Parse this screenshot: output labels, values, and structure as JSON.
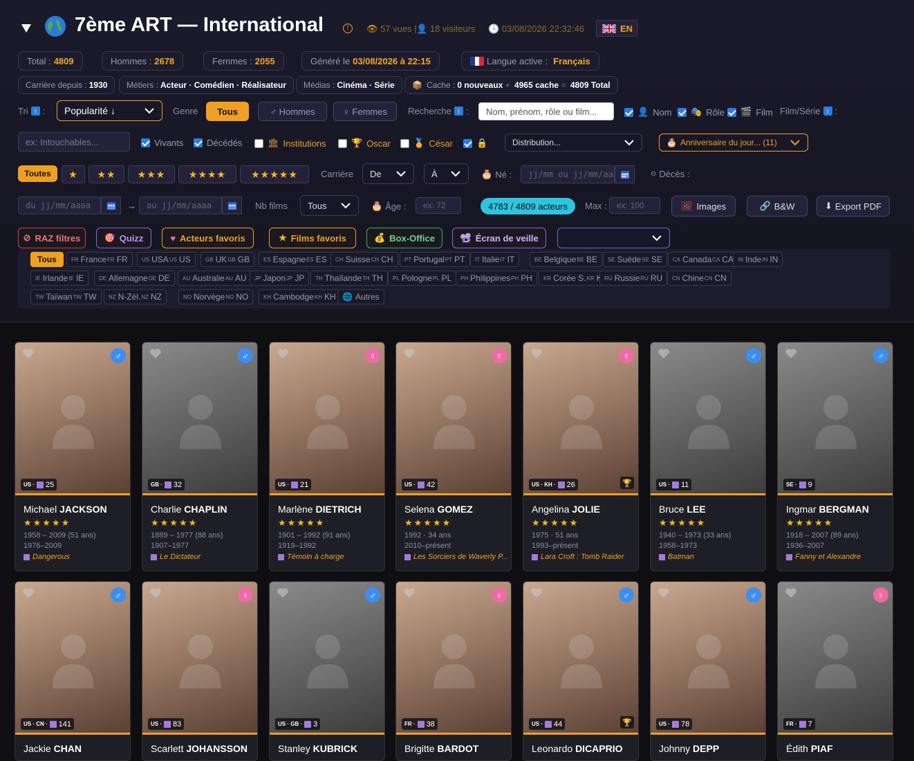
{
  "header": {
    "title": "7ème ART — International",
    "views": "57 vues |",
    "visitors": "18 visiteurs",
    "datetime": "03/08/2026 22:32:46",
    "lang_button": "EN"
  },
  "stats": {
    "total_label": "Total :",
    "total": "4809",
    "men_label": "Hommes :",
    "men": "2678",
    "women_label": "Femmes :",
    "women": "2055",
    "generated_label": "Généré le",
    "generated": "03/08/2026 à 22:15",
    "language_label": "Langue active :",
    "language": "Français"
  },
  "info": {
    "career_label": "Carrière depuis :",
    "career": "1930",
    "jobs_label": "Métiers :",
    "jobs": "Acteur · Comédien · Réalisateur",
    "media_label": "Médias :",
    "media": "Cinéma · Série",
    "cache_label": "Cache :",
    "cache_new": "0 nouveaux",
    "cache_plus": "+",
    "cache_count": "4965 cache",
    "cache_eq": "=",
    "cache_total": "4809 Total"
  },
  "filters": {
    "sort_label": "Tri",
    "sort_value": "Popularité ↓",
    "gender_label": "Genre",
    "gender_all": "Tous",
    "gender_men": "♂ Hommes",
    "gender_women": "♀ Femmes",
    "search_label": "Recherche",
    "search_placeholder": "Nom, prénom, rôle ou film...",
    "opt_name": "Nom",
    "opt_role": "Rôle",
    "opt_film": "Film",
    "filmserie_label": "Film/Série",
    "film_placeholder": "ex: Intouchables...",
    "alive": "Vivants",
    "dead": "Décédés",
    "institutions": "Institutions",
    "oscar": "Oscar",
    "cesar": "César",
    "distribution": "Distribution...",
    "birthday": "Anniversaire du jour... (11)",
    "stars_all": "Toutes",
    "career_label": "Carrière",
    "career_from": "De",
    "career_to": "À",
    "born_label": "Né :",
    "date_placeholder": "jj/mm ou jj/mm/aaaa",
    "death_label": "Décès :",
    "from_placeholder": "du jj/mm/aaaa",
    "arrow": "→",
    "to_placeholder": "au jj/mm/aaaa",
    "nbfilms_label": "Nb films",
    "nbfilms_value": "Tous",
    "age_label": "Âge :",
    "age_min_placeholder": "ex: 72",
    "count_badge": "4783 / 4809 acteurs",
    "max_label": "Max :",
    "max_placeholder": "ex: 100",
    "images": "Images",
    "bw": "B&W",
    "export": "Export PDF"
  },
  "actions": {
    "reset": "RAZ filtres",
    "quiz": "Quizz",
    "fav_actors": "Acteurs favoris",
    "fav_films": "Films favoris",
    "boxoffice": "Box-Office",
    "screensaver": "Écran de veille"
  },
  "countries": [
    {
      "label": "Tous"
    },
    {
      "code": "FR",
      "label": "France",
      "suffix": "FR"
    },
    {
      "code": "US",
      "label": "USA",
      "suffix": "US"
    },
    {
      "code": "GB",
      "label": "UK",
      "suffix": "GB"
    },
    {
      "code": "ES",
      "label": "Espagne",
      "suffix": "ES"
    },
    {
      "code": "CH",
      "label": "Suisse",
      "suffix": "CH"
    },
    {
      "code": "PT",
      "label": "Portugal",
      "suffix": "PT"
    },
    {
      "code": "IT",
      "label": "Italie",
      "suffix": "IT"
    },
    {
      "code": "BE",
      "label": "Belgique",
      "suffix": "BE"
    },
    {
      "code": "SE",
      "label": "Suède",
      "suffix": "SE"
    },
    {
      "code": "CA",
      "label": "Canada",
      "suffix": "CA"
    },
    {
      "code": "IN",
      "label": "Inde",
      "suffix": "IN"
    },
    {
      "code": "IE",
      "label": "Irlande",
      "suffix": "IE"
    },
    {
      "code": "DE",
      "label": "Allemagne",
      "suffix": "DE"
    },
    {
      "code": "AU",
      "label": "Australie",
      "suffix": "AU"
    },
    {
      "code": "JP",
      "label": "Japon",
      "suffix": "JP"
    },
    {
      "code": "TH",
      "label": "Thaïlande",
      "suffix": "TH"
    },
    {
      "code": "PL",
      "label": "Pologne",
      "suffix": "PL"
    },
    {
      "code": "PH",
      "label": "Philippines",
      "suffix": "PH"
    },
    {
      "code": "KR",
      "label": "Corée S.",
      "suffix": "KR"
    },
    {
      "code": "RU",
      "label": "Russie",
      "suffix": "RU"
    },
    {
      "code": "CN",
      "label": "Chine",
      "suffix": "CN"
    },
    {
      "code": "TW",
      "label": "Taïwan",
      "suffix": "TW"
    },
    {
      "code": "NZ",
      "label": "N-Zél.",
      "suffix": "NZ"
    },
    {
      "code": "NO",
      "label": "Norvège",
      "suffix": "NO"
    },
    {
      "code": "KH",
      "label": "Cambodge",
      "suffix": "KH"
    },
    {
      "label": "Autres"
    }
  ],
  "cards": [
    {
      "first": "Michael",
      "last": "JACKSON",
      "sex": "m",
      "countries": "US ·",
      "films": "25",
      "line1": "1958 – 2009 (51 ans)",
      "line2": "1976–2009",
      "film": "Dangerous",
      "trophy": false,
      "color": true
    },
    {
      "first": "Charlie",
      "last": "CHAPLIN",
      "sex": "m",
      "countries": "GB ·",
      "films": "32",
      "line1": "1889 – 1977 (88 ans)",
      "line2": "1907–1977",
      "film": "Le Dictateur",
      "trophy": false,
      "color": false
    },
    {
      "first": "Marlène",
      "last": "DIETRICH",
      "sex": "f",
      "countries": "US ·",
      "films": "21",
      "line1": "1901 – 1992 (91 ans)",
      "line2": "1919–1992",
      "film": "Témoin à charge",
      "trophy": false,
      "color": true
    },
    {
      "first": "Selena",
      "last": "GOMEZ",
      "sex": "f",
      "countries": "US ·",
      "films": "42",
      "line1": "1992 · 34 ans",
      "line2": "2010–présent",
      "film": "Les Sorciers de Waverly P...",
      "trophy": false,
      "color": true
    },
    {
      "first": "Angelina",
      "last": "JOLIE",
      "sex": "f",
      "countries": "US · KH ·",
      "films": "26",
      "line1": "1975 · 51 ans",
      "line2": "1993–présent",
      "film": "Lara Croft : Tomb Raider",
      "trophy": true,
      "color": true
    },
    {
      "first": "Bruce",
      "last": "LEE",
      "sex": "m",
      "countries": "US ·",
      "films": "11",
      "line1": "1940 – 1973 (33 ans)",
      "line2": "1958–1973",
      "film": "Batman",
      "trophy": false,
      "color": false
    },
    {
      "first": "Ingmar",
      "last": "BERGMAN",
      "sex": "m",
      "countries": "SE ·",
      "films": "9",
      "line1": "1918 – 2007 (89 ans)",
      "line2": "1936–2007",
      "film": "Fanny et Alexandre",
      "trophy": false,
      "color": false
    },
    {
      "first": "Jackie",
      "last": "CHAN",
      "sex": "m",
      "countries": "US · CN ·",
      "films": "141",
      "trophy": false,
      "color": true
    },
    {
      "first": "Scarlett",
      "last": "JOHANSSON",
      "sex": "f",
      "countries": "US ·",
      "films": "83",
      "trophy": false,
      "color": true
    },
    {
      "first": "Stanley",
      "last": "KUBRICK",
      "sex": "m",
      "countries": "US · GB ·",
      "films": "3",
      "trophy": false,
      "color": false
    },
    {
      "first": "Brigitte",
      "last": "BARDOT",
      "sex": "f",
      "countries": "FR ·",
      "films": "38",
      "trophy": false,
      "color": true
    },
    {
      "first": "Leonardo",
      "last": "DICAPRIO",
      "sex": "m",
      "countries": "US ·",
      "films": "44",
      "trophy": true,
      "color": true
    },
    {
      "first": "Johnny",
      "last": "DEPP",
      "sex": "m",
      "countries": "US ·",
      "films": "78",
      "trophy": false,
      "color": true
    },
    {
      "first": "Édith",
      "last": "PIAF",
      "sex": "f",
      "countries": "FR ·",
      "films": "7",
      "trophy": false,
      "color": false
    }
  ],
  "colors": {
    "accent": "#f0a020",
    "male": "#3b8ff0",
    "female": "#f06aa8",
    "bg": "#0f0f13"
  }
}
